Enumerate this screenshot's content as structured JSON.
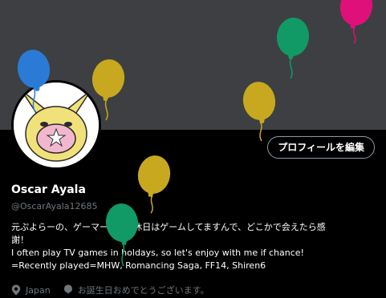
{
  "profile": {
    "edit_button": "プロフィールを編集",
    "name": "Oscar Ayala",
    "handle": "@OscarAyala12685",
    "bio_lines": [
      "元ぷよらーの、ゲーマーです。休日はゲームしてますんで、どこかで会えたら感",
      "謝！",
      "I often play TV games in holdays, so let's enjoy with me if chance!",
      "=Recently played=MHW, Romancing Saga, FF14, Shiren6"
    ],
    "location": "Japan",
    "birthday_text": "お誕生日おめでとうございます。"
  },
  "icons": {
    "location": "location-pin-icon",
    "birthday": "balloon-icon"
  },
  "colors": {
    "background": "#000000",
    "banner": "#3d3f42",
    "secondary_text": "#6e767d",
    "balloon_blue": "#2b7bd6",
    "balloon_yellow": "#c8a81e",
    "balloon_green": "#119966",
    "balloon_pink": "#e0107a"
  }
}
